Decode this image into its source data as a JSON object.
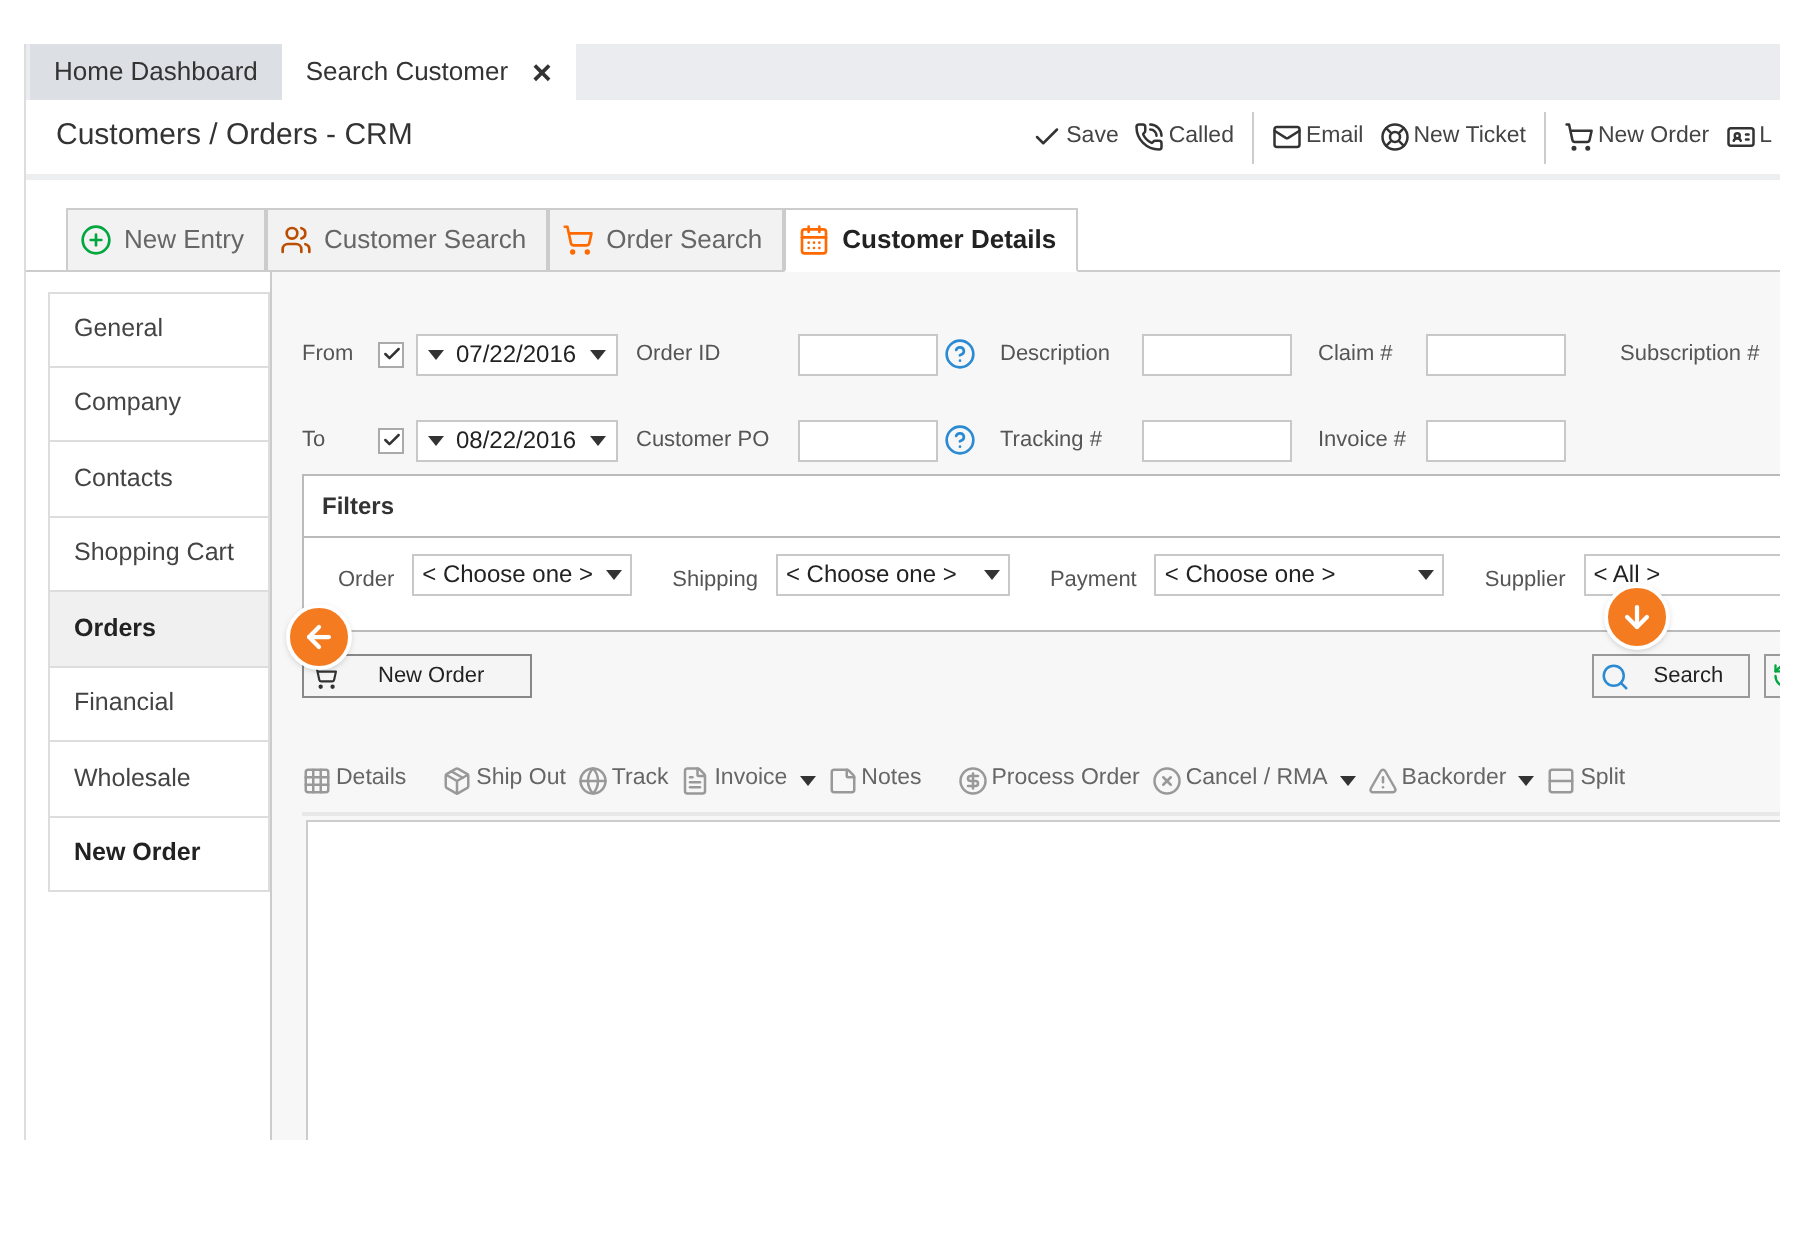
{
  "window_tabs": [
    {
      "label": "Home Dashboard",
      "selected": false,
      "closable": false
    },
    {
      "label": "Search Customer",
      "selected": true,
      "closable": true
    }
  ],
  "header": {
    "title": "Customers / Orders - CRM",
    "close_glyph": "×"
  },
  "actions": [
    {
      "label": "Save"
    },
    {
      "label": "Called"
    },
    {
      "label": "Email"
    },
    {
      "label": "New Ticket"
    },
    {
      "label": "New Order"
    },
    {
      "label": "L"
    }
  ],
  "section_tabs": [
    {
      "label": "New Entry",
      "selected": false
    },
    {
      "label": "Customer Search",
      "selected": false
    },
    {
      "label": "Order Search",
      "selected": false
    },
    {
      "label": "Customer Details",
      "selected": true
    }
  ],
  "sidebar": {
    "items": [
      {
        "label": "General",
        "selected": false,
        "bold": false
      },
      {
        "label": "Company",
        "selected": false,
        "bold": false
      },
      {
        "label": "Contacts",
        "selected": false,
        "bold": false
      },
      {
        "label": "Shopping Cart",
        "selected": false,
        "bold": false
      },
      {
        "label": "Orders",
        "selected": true,
        "bold": true
      },
      {
        "label": "Financial",
        "selected": false,
        "bold": false
      },
      {
        "label": "Wholesale",
        "selected": false,
        "bold": false
      },
      {
        "label": "New Order",
        "selected": false,
        "bold": true
      }
    ]
  },
  "form": {
    "from": {
      "label": "From",
      "checked": true,
      "value": "07/22/2016"
    },
    "to": {
      "label": "To",
      "checked": true,
      "value": "08/22/2016"
    },
    "order_id": {
      "label": "Order ID"
    },
    "customer_po": {
      "label": "Customer PO"
    },
    "description": {
      "label": "Description"
    },
    "tracking": {
      "label": "Tracking #"
    },
    "claim": {
      "label": "Claim #"
    },
    "invoice": {
      "label": "Invoice #"
    },
    "subscription": {
      "label": "Subscription #"
    }
  },
  "filters": {
    "title": "Filters",
    "fields": [
      {
        "label": "Order",
        "value": "< Choose one >"
      },
      {
        "label": "Shipping",
        "value": "< Choose one >"
      },
      {
        "label": "Payment",
        "value": "< Choose one >"
      },
      {
        "label": "Supplier",
        "value": "< All >"
      }
    ]
  },
  "buttons": {
    "new_order": "New Order",
    "search": "Search"
  },
  "toolbar": [
    {
      "label": "Details",
      "has_menu": false
    },
    {
      "label": "Ship Out",
      "has_menu": false
    },
    {
      "label": "Track",
      "has_menu": false
    },
    {
      "label": "Invoice",
      "has_menu": true
    },
    {
      "label": "Notes",
      "has_menu": false
    },
    {
      "label": "Process Order",
      "has_menu": false
    },
    {
      "label": "Cancel / RMA",
      "has_menu": true
    },
    {
      "label": "Backorder",
      "has_menu": true
    },
    {
      "label": "Split",
      "has_menu": false
    }
  ]
}
